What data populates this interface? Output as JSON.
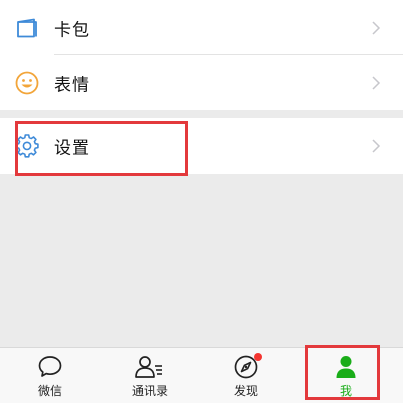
{
  "menu": {
    "card_label": "卡包",
    "emoji_label": "表情",
    "settings_label": "设置"
  },
  "tabs": [
    {
      "label": "微信",
      "icon": "chat-bubble-icon"
    },
    {
      "label": "通讯录",
      "icon": "contacts-icon"
    },
    {
      "label": "发现",
      "icon": "compass-icon",
      "badge": true
    },
    {
      "label": "我",
      "icon": "person-icon",
      "active": true
    }
  ],
  "colors": {
    "accent_green": "#1aad19",
    "highlight_red": "#e3393c",
    "card_icon_blue": "#3e8ad8",
    "emoji_icon_orange": "#f2a53a",
    "settings_icon_blue": "#3e8ad8",
    "badge_red": "#f43530"
  }
}
